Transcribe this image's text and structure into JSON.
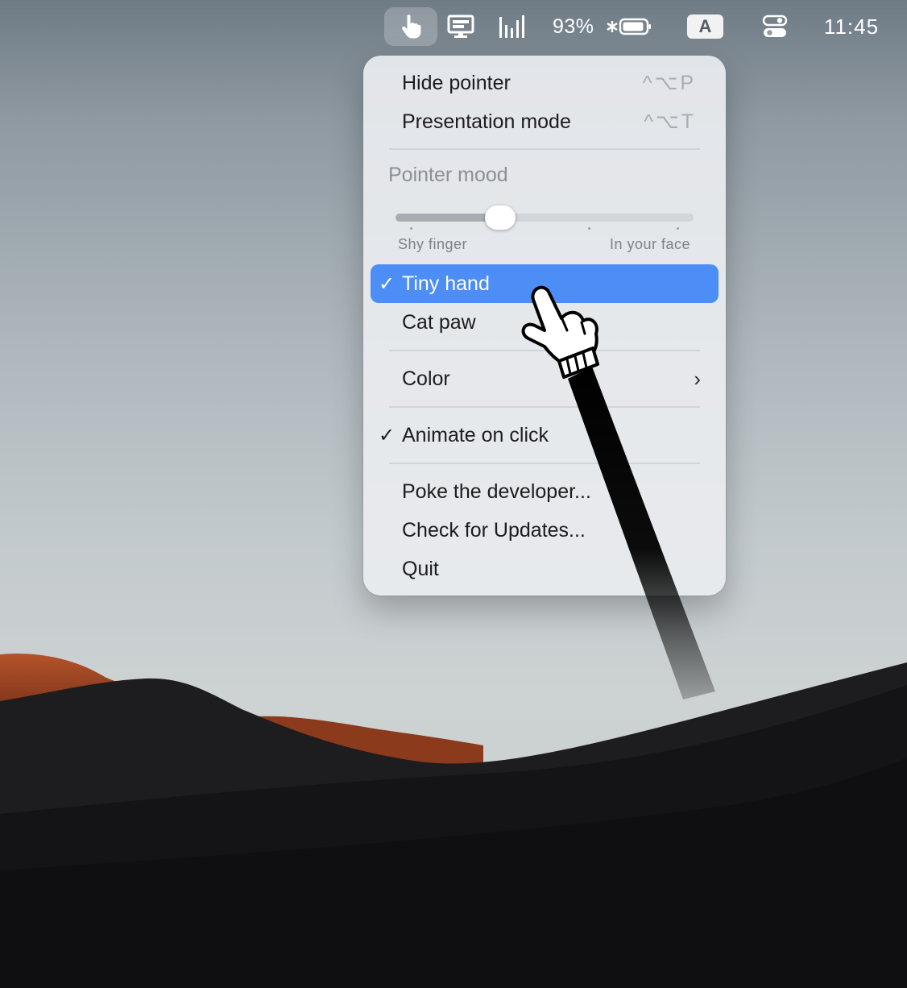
{
  "menubar": {
    "pointer_icon": "pointing-hand-icon",
    "monitor_icon": "monitor-icon",
    "bars_icon": "audio-bars-icon",
    "battery_percent": "93%",
    "battery_icon": "battery-charging-icon",
    "input_source": "A",
    "control_icon": "control-center-icon",
    "clock": "11:45"
  },
  "menu": {
    "hide_pointer": {
      "label": "Hide pointer",
      "shortcut": "^⌥P"
    },
    "presentation_mode": {
      "label": "Presentation mode",
      "shortcut": "^⌥T"
    },
    "section_title": "Pointer mood",
    "slider": {
      "min_label": "Shy finger",
      "max_label": "In your face",
      "value_fraction": 0.35
    },
    "tiny_hand": {
      "label": "Tiny hand",
      "checked": "✓"
    },
    "cat_paw": {
      "label": "Cat paw"
    },
    "color": {
      "label": "Color",
      "chevron": "›"
    },
    "animate": {
      "label": "Animate on click",
      "checked": "✓"
    },
    "poke": {
      "label": "Poke the developer..."
    },
    "updates": {
      "label": "Check for Updates..."
    },
    "quit": {
      "label": "Quit"
    }
  },
  "colors": {
    "selection": "#4d8ef6",
    "menu_bg": "#e9ecef"
  }
}
